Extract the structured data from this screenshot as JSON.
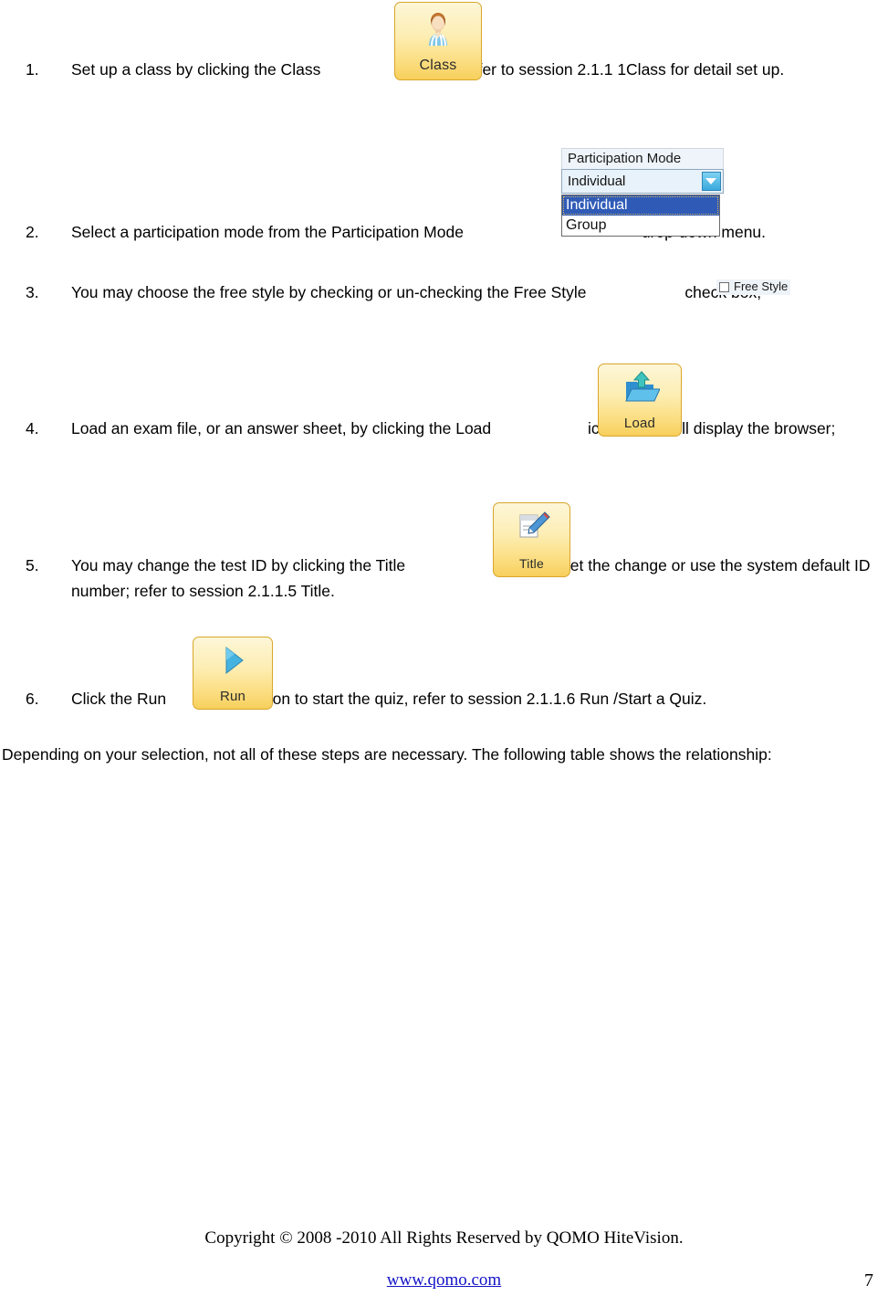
{
  "document": {
    "steps": [
      {
        "number": "1.",
        "text_before": "Set up a class by clicking the Class",
        "text_after": "icon, refer to session 2.1.1 1Class for detail set up.",
        "widget": "class-icon"
      },
      {
        "number": "2.",
        "text_before": "Select a participation mode from the Participation Mode",
        "text_after": "drop-down menu.",
        "widget": "participation-mode-dropdown"
      },
      {
        "number": "3.",
        "text_before": "You may choose the free style by checking or un-checking the Free Style",
        "text_after": "check box;",
        "widget": "free-style-checkbox"
      },
      {
        "number": "4.",
        "text_before": "Load an exam file, or an answer sheet, by clicking the Load",
        "text_after": "icon which will display the browser;",
        "widget": "load-icon"
      },
      {
        "number": "5.",
        "text_before": "You may change the test ID by clicking the Title",
        "text_after": "icon and set the change or use the system default ID number; refer to session 2.1.1.5 Title.",
        "widget": "title-icon"
      },
      {
        "number": "6.",
        "text_before": "Click the Run",
        "text_after": "icon to start the quiz, refer to session 2.1.1.6 Run /Start a Quiz.",
        "widget": "run-icon"
      }
    ],
    "paragraph": "Depending on your selection, not all of these steps are necessary. The following table shows the relationship:"
  },
  "widgets": {
    "class_button": {
      "label": "Class",
      "icon": "user-avatar-icon"
    },
    "load_button": {
      "label": "Load",
      "icon": "open-folder-upload-icon"
    },
    "title_button": {
      "label": "Title",
      "icon": "note-pencil-icon"
    },
    "run_button": {
      "label": "Run",
      "icon": "play-triangle-icon"
    },
    "participation_mode": {
      "label": "Participation Mode",
      "selected": "Individual",
      "options": [
        "Individual",
        "Group"
      ]
    },
    "free_style": {
      "label": "Free Style",
      "checked": false
    }
  },
  "footer": {
    "copyright": "Copyright © 2008 -2010 All Rights Reserved by QOMO HiteVision.",
    "url": "www.qomo.com",
    "page_number": "7"
  },
  "colors": {
    "button_border": "#d9a62b",
    "button_gradient_top": "#fdf6d8",
    "button_gradient_bottom": "#f7cf5c",
    "dropdown_highlight": "#2f5bb7",
    "dropdown_arrow": "#3aa9dd",
    "link": "#1414c8"
  }
}
